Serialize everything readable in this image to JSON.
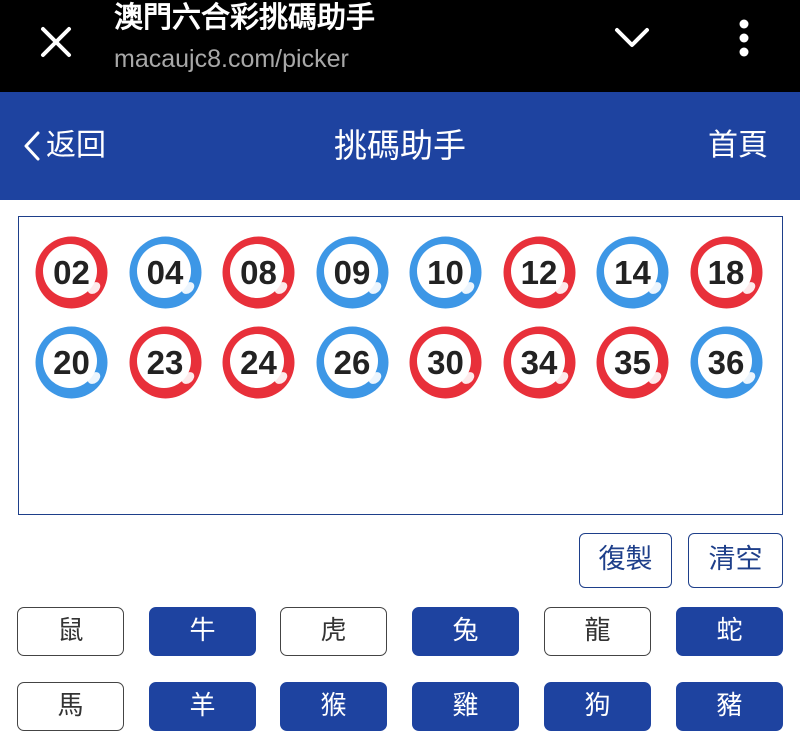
{
  "browser": {
    "page_title": "澳門六合彩挑碼助手",
    "url": "macaujc8.com/picker"
  },
  "header": {
    "back_label": "返回",
    "title": "挑碼助手",
    "home_label": "首頁"
  },
  "selected_numbers": [
    {
      "num": "02",
      "color": "red"
    },
    {
      "num": "04",
      "color": "blue"
    },
    {
      "num": "08",
      "color": "red"
    },
    {
      "num": "09",
      "color": "blue"
    },
    {
      "num": "10",
      "color": "blue"
    },
    {
      "num": "12",
      "color": "red"
    },
    {
      "num": "14",
      "color": "blue"
    },
    {
      "num": "18",
      "color": "red"
    },
    {
      "num": "20",
      "color": "blue"
    },
    {
      "num": "23",
      "color": "red"
    },
    {
      "num": "24",
      "color": "red"
    },
    {
      "num": "26",
      "color": "blue"
    },
    {
      "num": "30",
      "color": "red"
    },
    {
      "num": "34",
      "color": "red"
    },
    {
      "num": "35",
      "color": "red"
    },
    {
      "num": "36",
      "color": "blue"
    }
  ],
  "ball_colors": {
    "red": "#e8303a",
    "blue": "#3d97e6"
  },
  "actions": {
    "copy_label": "復製",
    "clear_label": "清空"
  },
  "zodiac": [
    {
      "label": "鼠",
      "selected": false
    },
    {
      "label": "牛",
      "selected": true
    },
    {
      "label": "虎",
      "selected": false
    },
    {
      "label": "兔",
      "selected": true
    },
    {
      "label": "龍",
      "selected": false
    },
    {
      "label": "蛇",
      "selected": true
    },
    {
      "label": "馬",
      "selected": false
    },
    {
      "label": "羊",
      "selected": true
    },
    {
      "label": "猴",
      "selected": true
    },
    {
      "label": "雞",
      "selected": true
    },
    {
      "label": "狗",
      "selected": true
    },
    {
      "label": "豬",
      "selected": true
    }
  ],
  "theme": {
    "header_bg": "#1e43a0",
    "browser_bg": "#000000"
  }
}
